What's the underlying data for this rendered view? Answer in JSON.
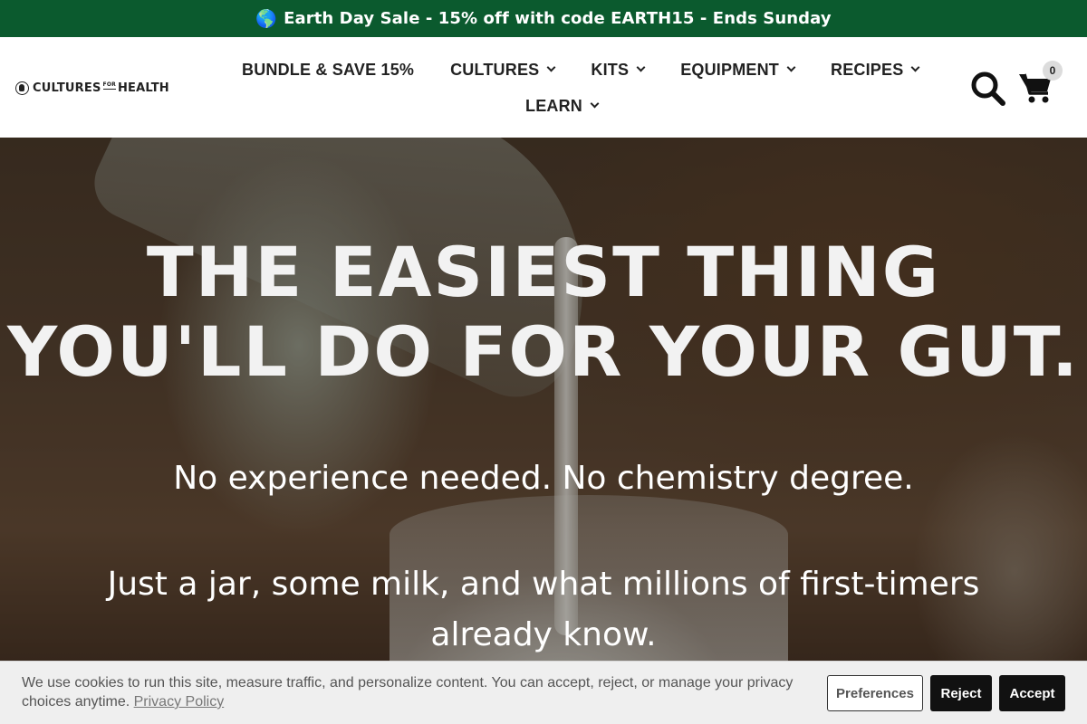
{
  "announcement": {
    "icon": "globe-emoji",
    "globe": "🌎",
    "text": "Earth Day Sale - 15% off with code EARTH15 - Ends Sunday",
    "background": "#0b5a2e"
  },
  "header": {
    "logo": {
      "left": "CULTURES",
      "for": "FOR",
      "right": "HEALTH"
    },
    "nav": [
      {
        "label": "BUNDLE & SAVE 15%",
        "dropdown": false
      },
      {
        "label": "CULTURES",
        "dropdown": true
      },
      {
        "label": "KITS",
        "dropdown": true
      },
      {
        "label": "EQUIPMENT",
        "dropdown": true
      },
      {
        "label": "RECIPES",
        "dropdown": true
      },
      {
        "label": "LEARN",
        "dropdown": true
      }
    ],
    "search_icon": "search-icon",
    "cart_icon": "cart-icon",
    "cart_count": "0"
  },
  "hero": {
    "headline": "THE EASIEST THING YOU'LL DO FOR YOUR GUT.",
    "subtitle_1": "No experience needed. No chemistry degree.",
    "subtitle_2": "Just a jar, some milk, and what millions of first-timers already know."
  },
  "cookie_banner": {
    "text": "We use cookies to run this site, measure traffic, and personalize content. You can accept, reject, or manage your privacy choices anytime.",
    "link": "Privacy Policy",
    "preferences_label": "Preferences",
    "reject_label": "Reject",
    "accept_label": "Accept"
  }
}
